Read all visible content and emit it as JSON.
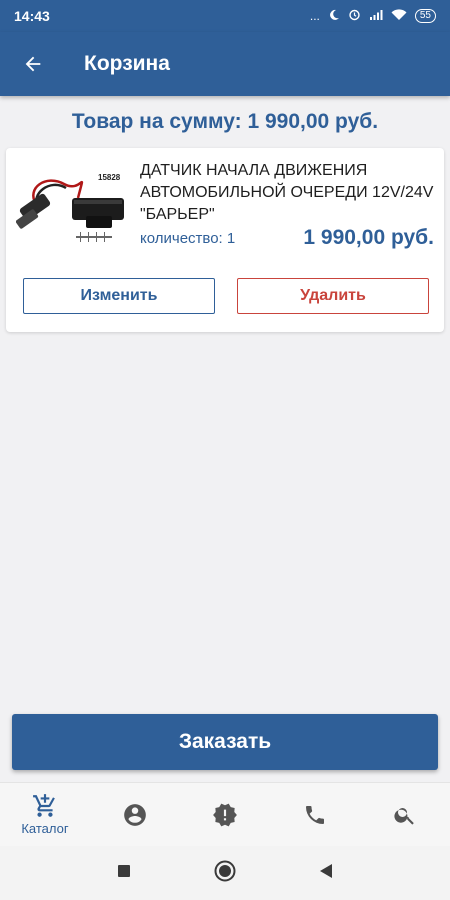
{
  "status_bar": {
    "time": "14:43",
    "dots": "...",
    "battery": "55"
  },
  "app_bar": {
    "title": "Корзина"
  },
  "summary": {
    "text": "Товар на сумму: 1 990,00 руб."
  },
  "cart_item": {
    "image_label": "15828",
    "name": "ДАТЧИК НАЧАЛА ДВИЖЕНИЯ АВТОМОБИЛЬНОЙ ОЧЕРЕДИ 12V/24V \"БАРЬЕР\"",
    "quantity": "количество: 1",
    "price": "1 990,00 руб.",
    "edit_label": "Изменить",
    "delete_label": "Удалить"
  },
  "order_button": {
    "label": "Заказать"
  },
  "bottom_nav": {
    "catalog_label": "Каталог",
    "items": [
      "catalog-icon",
      "account-icon",
      "alert-icon",
      "phone-icon",
      "search-icon"
    ]
  },
  "colors": {
    "primary": "#2f5f98",
    "danger": "#c9443c",
    "background": "#f1f1f3"
  }
}
